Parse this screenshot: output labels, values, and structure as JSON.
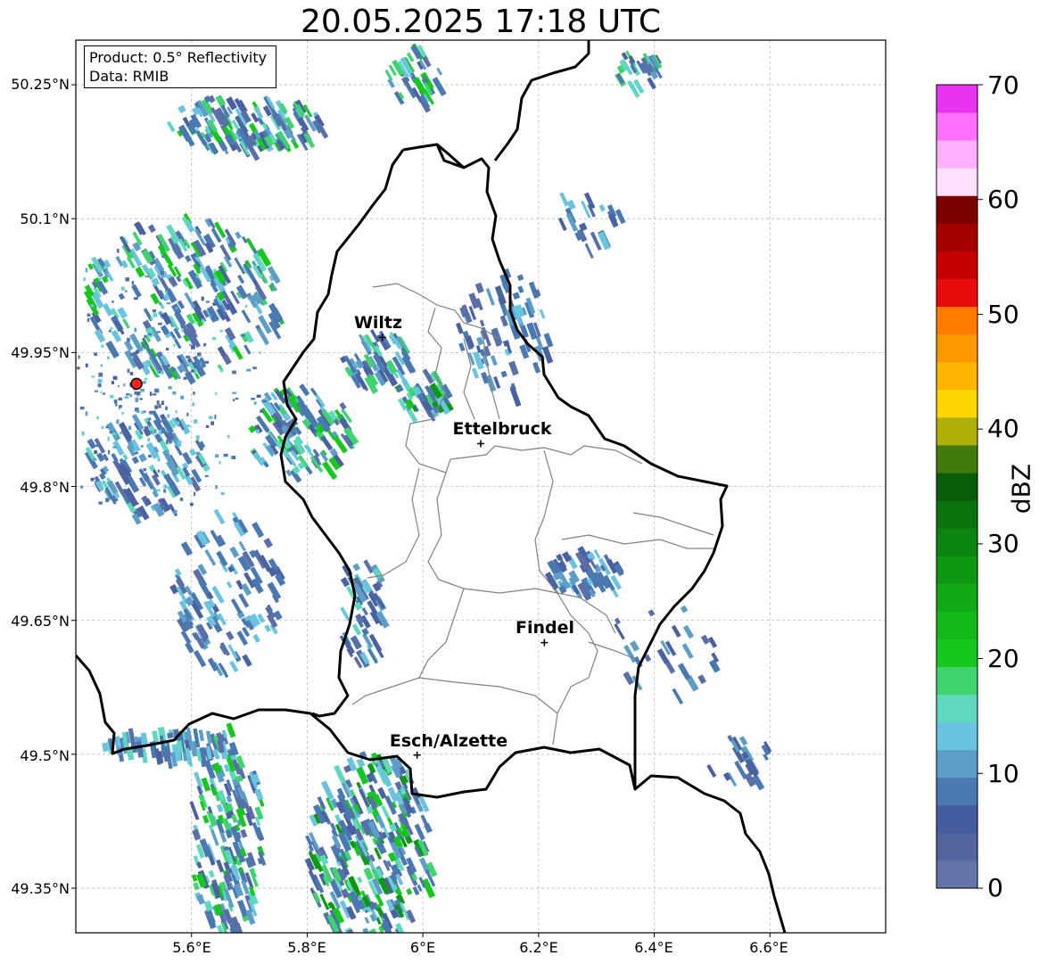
{
  "title": "20.05.2025 17:18 UTC",
  "info_box": {
    "product": "Product: 0.5° Reflectivity",
    "data": "Data: RMIB"
  },
  "axes": {
    "lat_labels": [
      "50.25°N",
      "50.1°N",
      "49.95°N",
      "49.8°N",
      "49.65°N",
      "49.5°N",
      "49.35°N"
    ],
    "lon_labels": [
      "5.6°E",
      "5.8°E",
      "6°E",
      "6.2°E",
      "6.4°E",
      "6.6°E"
    ],
    "lon_range": [
      5.4,
      6.8
    ],
    "lat_range": [
      49.3,
      50.3
    ],
    "gridlines": true
  },
  "cities": [
    {
      "name": "Wiltz",
      "lon": 5.93,
      "lat": 49.967
    },
    {
      "name": "Ettelbruck",
      "lon": 6.1,
      "lat": 49.848
    },
    {
      "name": "Findel",
      "lon": 6.21,
      "lat": 49.625
    },
    {
      "name": "Esch/Alzette",
      "lon": 5.99,
      "lat": 49.499
    }
  ],
  "radar_site": {
    "lon": 5.505,
    "lat": 49.915,
    "color": "#ff2020"
  },
  "colorbar": {
    "label": "dBZ",
    "ticks": [
      "0",
      "10",
      "20",
      "30",
      "40",
      "50",
      "60",
      "70"
    ],
    "colors": [
      "#6474a8",
      "#54649e",
      "#445ca0",
      "#4a78b0",
      "#5c9ec8",
      "#6ac4e0",
      "#60d8c0",
      "#40d470",
      "#14c81e",
      "#12b818",
      "#10a814",
      "#0e9812",
      "#0c8410",
      "#0a720c",
      "#085c0a",
      "#437a0c",
      "#afb10a",
      "#ffd700",
      "#ffb400",
      "#ff9800",
      "#ff7c00",
      "#e80c0c",
      "#c40000",
      "#a40000",
      "#7c0000",
      "#ffe0ff",
      "#ffb0ff",
      "#ff70ff",
      "#e834ee"
    ]
  }
}
